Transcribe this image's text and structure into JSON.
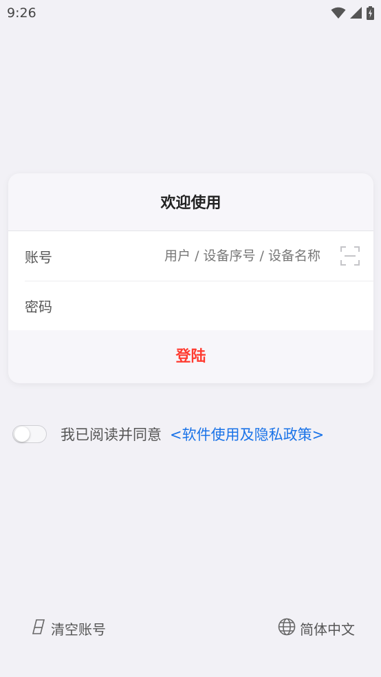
{
  "status_bar": {
    "time": "9:26",
    "icons": [
      "wifi-icon",
      "signal-icon",
      "battery-charging-icon"
    ]
  },
  "login_card": {
    "title": "欢迎使用",
    "account": {
      "label": "账号",
      "value": "",
      "placeholder": "用户 / 设备序号 / 设备名称"
    },
    "password": {
      "label": "密码",
      "value": "",
      "placeholder": ""
    },
    "login_button": "登陆"
  },
  "agreement": {
    "checked": false,
    "text": "我已阅读并同意",
    "link": "<软件使用及隐私政策>"
  },
  "footer": {
    "clear_account": "清空账号",
    "language": "简体中文"
  },
  "colors": {
    "background": "#f2f1f6",
    "login_button": "#ff3b30",
    "link": "#1a73e8"
  }
}
